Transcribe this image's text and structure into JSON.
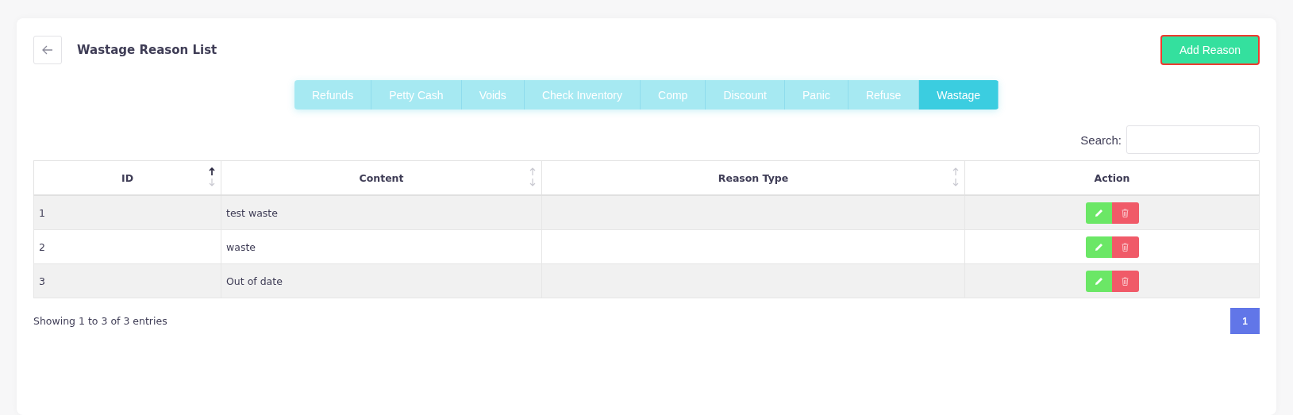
{
  "header": {
    "title": "Wastage Reason List",
    "add_button": "Add Reason"
  },
  "tabs": [
    {
      "label": "Refunds",
      "selected": false
    },
    {
      "label": "Petty Cash",
      "selected": false
    },
    {
      "label": "Voids",
      "selected": false
    },
    {
      "label": "Check Inventory",
      "selected": false
    },
    {
      "label": "Comp",
      "selected": false
    },
    {
      "label": "Discount",
      "selected": false
    },
    {
      "label": "Panic",
      "selected": false
    },
    {
      "label": "Refuse",
      "selected": false
    },
    {
      "label": "Wastage",
      "selected": true
    }
  ],
  "search": {
    "label": "Search:"
  },
  "table": {
    "columns": [
      {
        "label": "ID",
        "sortable": true,
        "sorted": true
      },
      {
        "label": "Content",
        "sortable": true,
        "sorted": false
      },
      {
        "label": "Reason Type",
        "sortable": true,
        "sorted": false
      },
      {
        "label": "Action",
        "sortable": false
      }
    ],
    "rows": [
      {
        "id": "1",
        "content": "test waste"
      },
      {
        "id": "2",
        "content": "waste"
      },
      {
        "id": "3",
        "content": "Out of date"
      }
    ]
  },
  "footer": {
    "info": "Showing 1 to 3 of 3 entries",
    "pages": [
      {
        "label": "1",
        "selected": true
      }
    ]
  }
}
